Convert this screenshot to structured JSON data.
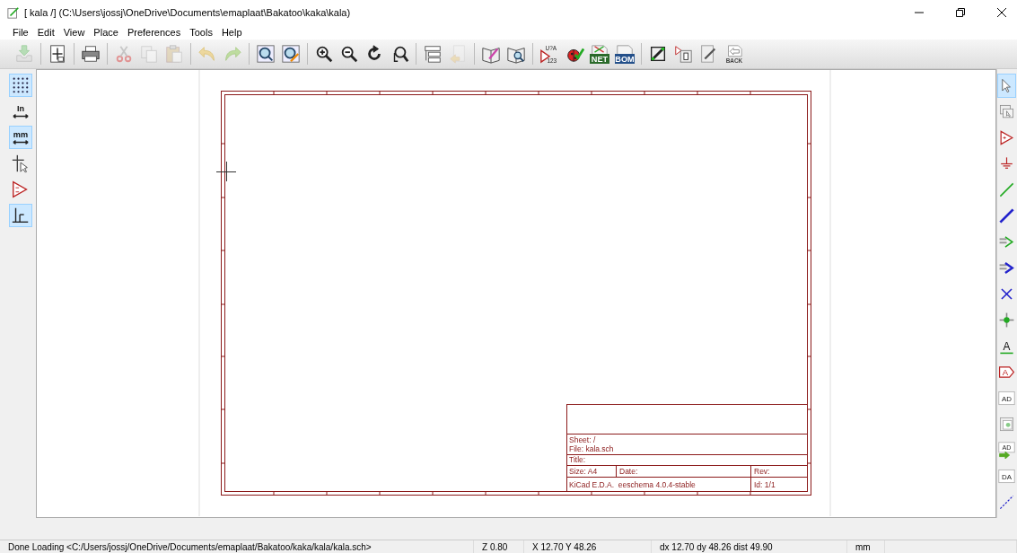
{
  "window": {
    "title": "[ kala /] (C:\\Users\\jossj\\OneDrive\\Documents\\emaplaat\\Bakatoo\\kaka\\kala)"
  },
  "menu": [
    "File",
    "Edit",
    "View",
    "Place",
    "Preferences",
    "Tools",
    "Help"
  ],
  "toolbar": {
    "groups": [
      [
        {
          "kind": "save",
          "disabled": true
        }
      ],
      [
        {
          "kind": "page-settings",
          "disabled": false
        }
      ],
      [
        {
          "kind": "print",
          "disabled": false
        }
      ],
      [
        {
          "kind": "cut",
          "disabled": true
        },
        {
          "kind": "copy",
          "disabled": true
        },
        {
          "kind": "paste",
          "disabled": true
        }
      ],
      [
        {
          "kind": "undo",
          "disabled": true
        },
        {
          "kind": "redo",
          "disabled": true
        }
      ],
      [
        {
          "kind": "find",
          "disabled": false
        },
        {
          "kind": "find-replace",
          "disabled": false
        }
      ],
      [
        {
          "kind": "zoom-in",
          "disabled": false
        },
        {
          "kind": "zoom-out",
          "disabled": false
        },
        {
          "kind": "redraw",
          "disabled": false
        },
        {
          "kind": "zoom-fit",
          "disabled": false
        }
      ],
      [
        {
          "kind": "hierarchy",
          "disabled": false
        },
        {
          "kind": "leave-sheet",
          "disabled": true
        }
      ],
      [
        {
          "kind": "lib-edit",
          "disabled": false
        },
        {
          "kind": "lib-browse",
          "disabled": false
        }
      ],
      [
        {
          "kind": "annotate",
          "disabled": false,
          "labels": [
            "U?A",
            "123"
          ]
        },
        {
          "kind": "erc",
          "disabled": false
        },
        {
          "kind": "netlist",
          "disabled": false,
          "labels": [
            "NET"
          ]
        },
        {
          "kind": "bom",
          "disabled": false,
          "labels": [
            "BOM"
          ]
        }
      ],
      [
        {
          "kind": "fp-assign",
          "disabled": false
        },
        {
          "kind": "fp-import",
          "disabled": false
        },
        {
          "kind": "backannotate",
          "disabled": false
        },
        {
          "kind": "back",
          "disabled": false,
          "labels": [
            "BACK"
          ]
        }
      ]
    ]
  },
  "left_toolbar": [
    {
      "kind": "grid",
      "selected": true
    },
    {
      "kind": "units",
      "selected": false,
      "labels": [
        "In"
      ]
    },
    {
      "kind": "units",
      "selected": true,
      "labels": [
        "mm"
      ]
    },
    {
      "kind": "cursor",
      "selected": false
    },
    {
      "kind": "hier-pins",
      "selected": false
    },
    {
      "kind": "bus-wire",
      "selected": true
    }
  ],
  "right_toolbar": [
    {
      "kind": "select",
      "selected": true
    },
    {
      "kind": "hier-nav",
      "selected": false
    },
    {
      "kind": "component",
      "selected": false
    },
    {
      "kind": "power",
      "selected": false
    },
    {
      "kind": "wire",
      "selected": false
    },
    {
      "kind": "bus",
      "selected": false
    },
    {
      "kind": "wire-entry",
      "selected": false
    },
    {
      "kind": "bus-entry",
      "selected": false
    },
    {
      "kind": "no-connect",
      "selected": false
    },
    {
      "kind": "junction",
      "selected": false
    },
    {
      "kind": "net-label",
      "selected": false,
      "labels": [
        "A"
      ]
    },
    {
      "kind": "global-label",
      "selected": false,
      "labels": [
        "A"
      ]
    },
    {
      "kind": "hier-label",
      "selected": false,
      "labels": [
        "AD"
      ]
    },
    {
      "kind": "sheet",
      "selected": false
    },
    {
      "kind": "import-pin",
      "selected": false,
      "labels": [
        "AD"
      ]
    },
    {
      "kind": "sheet-pin",
      "selected": false,
      "labels": [
        "DA"
      ]
    },
    {
      "kind": "line",
      "selected": false
    }
  ],
  "sheet": {
    "title_block": {
      "sheet": "Sheet: /",
      "file": "File: kala.sch",
      "title": "Title:",
      "size": "Size: A4",
      "date": "Date:",
      "rev": "Rev:",
      "tool": "KiCad E.D.A.  eeschema 4.0.4-stable",
      "id": "Id: 1/1"
    }
  },
  "status_bar": [
    "Done Loading <C:/Users/jossj/OneDrive/Documents/emaplaat/Bakatoo/kaka/kala/kala.sch>",
    "Z 0.80",
    "X 12.70  Y 48.26",
    "dx 12.70  dy 48.26  dist 49.90",
    "mm"
  ]
}
